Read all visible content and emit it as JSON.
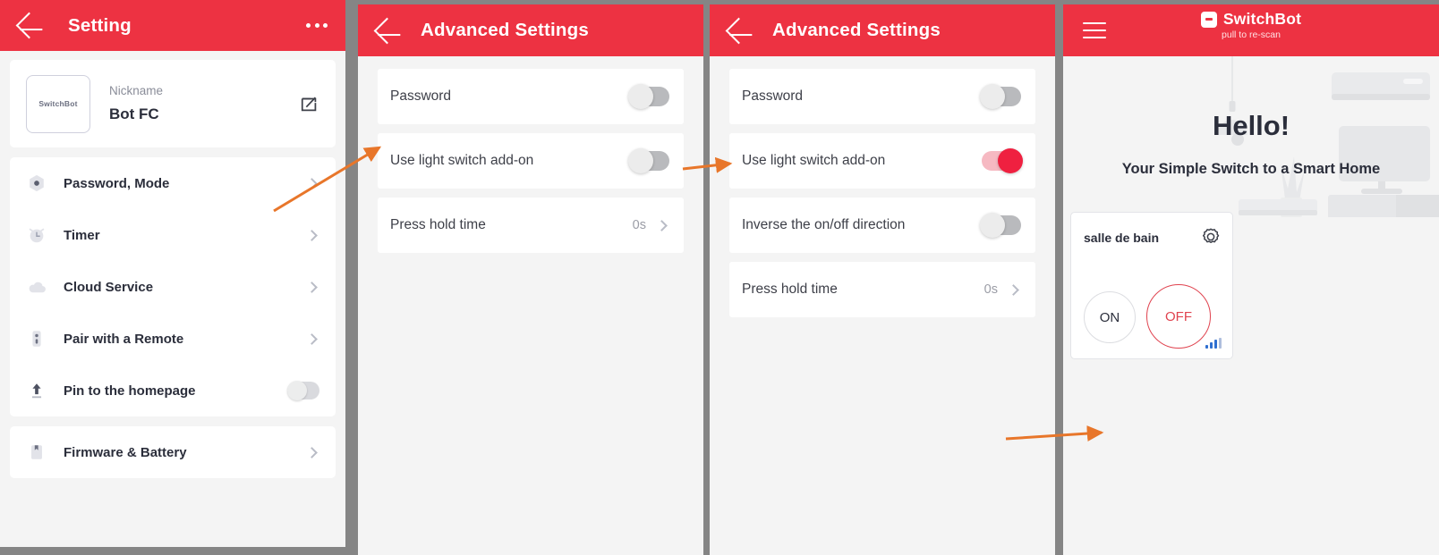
{
  "panel1": {
    "header": {
      "title": "Setting",
      "back_icon": "back-arrow-icon",
      "more_icon": "more-options-icon"
    },
    "device": {
      "thumb_text": "SwitchBot",
      "nickname_label": "Nickname",
      "nickname_value": "Bot FC",
      "edit_icon": "edit-pencil-icon"
    },
    "menu": [
      {
        "label": "Password, Mode",
        "icon": "gear-hexagon-icon",
        "accessory": "chevron"
      },
      {
        "label": "Timer",
        "icon": "alarm-clock-icon",
        "accessory": "chevron"
      },
      {
        "label": "Cloud Service",
        "icon": "cloud-icon",
        "accessory": "chevron"
      },
      {
        "label": "Pair with a Remote",
        "icon": "remote-control-icon",
        "accessory": "chevron"
      },
      {
        "label": "Pin to the homepage",
        "icon": "upload-arrow-icon",
        "accessory": "toggle",
        "toggle_on": false
      }
    ],
    "firmware": {
      "label": "Firmware & Battery",
      "icon": "bookmark-battery-icon",
      "accessory": "chevron"
    }
  },
  "panel2": {
    "header": {
      "title": "Advanced Settings",
      "back_icon": "back-arrow-icon"
    },
    "rows": [
      {
        "label": "Password",
        "type": "toggle",
        "toggle_on": false
      },
      {
        "label": "Use light switch add-on",
        "type": "toggle",
        "toggle_on": false
      },
      {
        "label": "Press hold time",
        "type": "value",
        "value": "0s"
      }
    ]
  },
  "panel3": {
    "header": {
      "title": "Advanced Settings",
      "back_icon": "back-arrow-icon"
    },
    "rows": [
      {
        "label": "Password",
        "type": "toggle",
        "toggle_on": false
      },
      {
        "label": "Use light switch add-on",
        "type": "toggle",
        "toggle_on": true
      },
      {
        "label": "Inverse the on/off direction",
        "type": "toggle",
        "toggle_on": false
      },
      {
        "label": "Press hold time",
        "type": "value",
        "value": "0s"
      }
    ]
  },
  "panel4": {
    "header": {
      "menu_icon": "hamburger-menu-icon",
      "brand_name": "SwitchBot",
      "brand_subtitle": "pull to re-scan",
      "brand_mark_icon": "switchbot-logo-icon"
    },
    "hero": {
      "greeting": "Hello!",
      "tagline": "Your Simple Switch to a Smart Home"
    },
    "device_card": {
      "name": "salle de bain",
      "gear_icon": "gear-icon",
      "on_label": "ON",
      "off_label": "OFF",
      "signal_icon": "signal-strength-icon"
    }
  },
  "colors": {
    "brand_red": "#ed3242",
    "toggle_on_red": "#ef2040",
    "toggle_off_gray": "#b9babd",
    "annotation_orange": "#e8762a",
    "page_bg": "#f4f4f4",
    "frame_gray": "#858585"
  }
}
